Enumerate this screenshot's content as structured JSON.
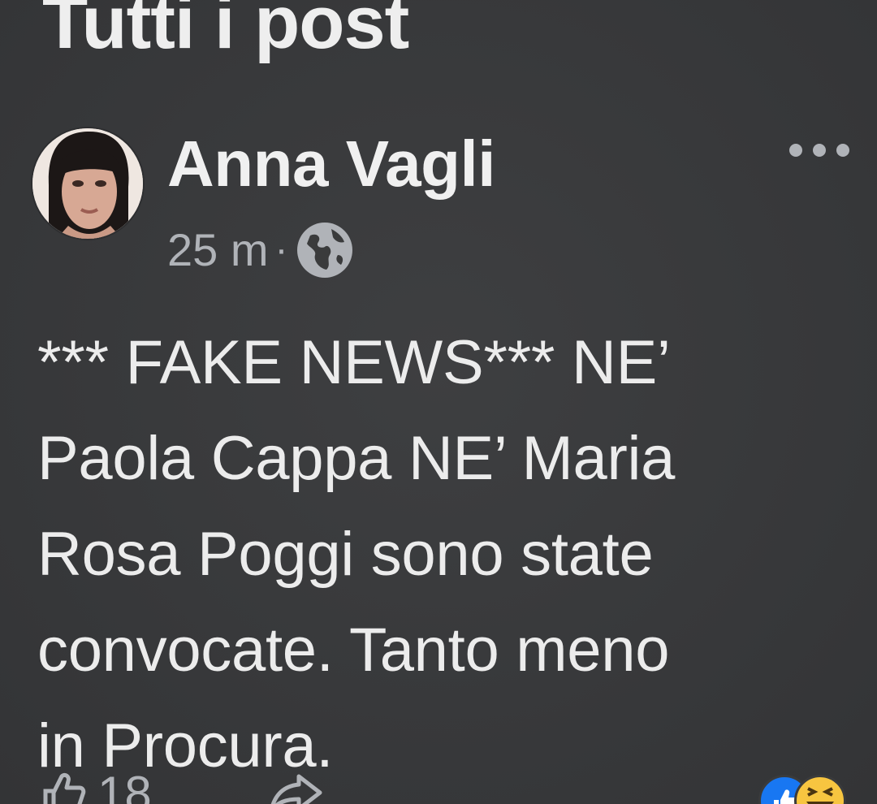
{
  "page": {
    "section_title": "Tutti i post"
  },
  "post": {
    "author": "Anna Vagli",
    "time": "25 m",
    "separator": "·",
    "visibility_icon": "globe-icon",
    "more_icon": "more-options-icon",
    "text": "*** FAKE NEWS***  NE’\nPaola Cappa NE’ Maria\nRosa Poggi sono state\nconvocate. Tanto meno\nin Procura.",
    "likes_count": "18",
    "reactions": [
      "like-reaction-icon",
      "haha-reaction-icon"
    ]
  },
  "colors": {
    "background": "#3a3b3c",
    "primary_text": "#e9e9e9",
    "secondary_text": "#b0b3b8",
    "like_blue": "#1877f2",
    "haha_yellow": "#f7c540"
  }
}
